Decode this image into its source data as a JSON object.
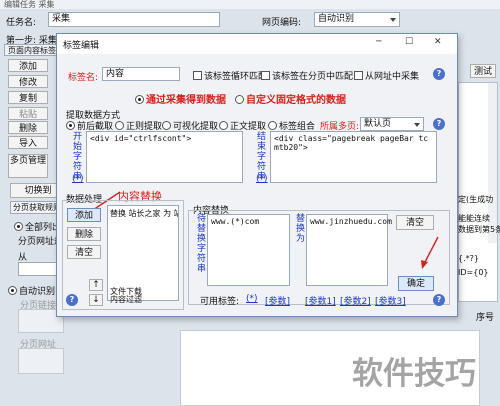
{
  "bg": {
    "title": "编辑任务 采集",
    "task_label": "任务名:",
    "task_value": "采集",
    "encoding_label": "网页编码:",
    "encoding_value": "自动识别",
    "step1": "第一步: 采集",
    "list_rules": "页面内容标签",
    "test_btn": "测试",
    "side_buttons": [
      "添加",
      "修改",
      "复制",
      "粘贴",
      "删除",
      "导入",
      "多页管理"
    ],
    "switch_btn": "切换到",
    "pagination": "分页获取规则",
    "radio_all": "全部列出",
    "page_url": "分页网址规",
    "from": "从",
    "auto_detect": "自动识别",
    "page_link": "分页链接",
    "page_url2": "分页网址",
    "right_text": "定(生成功",
    "right_text2": "能能连续",
    "right_text3": "数据到第5条",
    "right_text4": "{.*?}",
    "right_text5": "ID={0}",
    "col_header": "序号"
  },
  "dialog": {
    "title": "标签编辑",
    "minimize": "─",
    "maximize": "☐",
    "close": "✕",
    "tag_name_label": "标签名:",
    "tag_name_value": "内容",
    "cb_loop": "该标签循环匹配",
    "cb_page": "该标签在分页中匹配",
    "cb_url": "从网址中采集",
    "mode_collect": "通过采集得到数据",
    "mode_custom": "自定义固定格式的数据",
    "extract_label": "提取数据方式",
    "methods": [
      "前后截取",
      "正则提取",
      "可视化提取",
      "正文提取",
      "标签组合"
    ],
    "page_label": "所属多页:",
    "page_value": "默认页",
    "start_label": "开始字符串",
    "start_value": "<div id=\"ctrlfscont\">",
    "end_label": "结束字符串",
    "end_value": "<div class=\"pagebreak pageBar tc mtb20\">",
    "data_proc_label": "数据处理",
    "content_replace_red": "内容替换",
    "dp_add": "添加",
    "dp_del": "删除",
    "dp_clear": "清空",
    "dp_list": [
      "替换 站长之家 为 站"
    ],
    "dp_list_bottom": [
      "文件下载",
      "内容过滤"
    ],
    "up": "↑",
    "down": "↓",
    "cr_label": "内容替换",
    "find_label": "待替换字符串",
    "find_value": "www.(*)com",
    "rep_label": "替换为",
    "rep_value": "www.jinzhuedu.com",
    "clear_btn": "清空",
    "ok_btn": "确定",
    "avail_label": "可用标签:",
    "tags": [
      "(*)",
      "[参数]",
      "[参数1]",
      "[参数2]",
      "[参数3]"
    ],
    "help": "?"
  },
  "watermark": "软件技巧"
}
